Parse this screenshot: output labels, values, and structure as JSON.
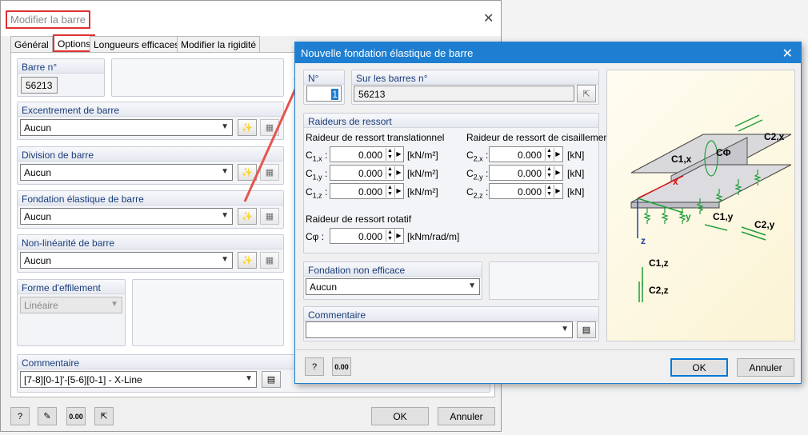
{
  "back_dialog": {
    "title": "Modifier la barre",
    "tabs": [
      "Général",
      "Options",
      "Longueurs efficaces",
      "Modifier la rigidité"
    ],
    "barre_label": "Barre n°",
    "barre_value": "56213",
    "excentrement": {
      "label": "Excentrement de barre",
      "value": "Aucun"
    },
    "division": {
      "label": "Division de barre",
      "value": "Aucun"
    },
    "fondation": {
      "label": "Fondation élastique de barre",
      "value": "Aucun"
    },
    "nonlinearite": {
      "label": "Non-linéarité de barre",
      "value": "Aucun"
    },
    "effilement": {
      "label": "Forme d'effilement",
      "value": "Linéaire"
    },
    "commentaire": {
      "label": "Commentaire",
      "value": "[7-8][0-1]'-[5-6][0-1] - X-Line"
    },
    "ok": "OK",
    "annuler": "Annuler"
  },
  "front_dialog": {
    "title": "Nouvelle fondation élastique de barre",
    "no_label": "N°",
    "no_value": "1",
    "barres_label": "Sur les barres n°",
    "barres_value": "56213",
    "raideurs_label": "Raideurs de ressort",
    "trans_label": "Raideur de ressort translationnel",
    "cis_label": "Raideur de ressort de cisaillement",
    "rot_label": "Raideur de ressort rotatif",
    "c1x": "C1,x :",
    "c1y": "C1,y :",
    "c1z": "C1,z :",
    "c2x": "C2,x :",
    "c2y": "C2,y :",
    "c2z": "C2,z :",
    "cphi": "Cφ :",
    "value_c1x": "0.000",
    "value_c1y": "0.000",
    "value_c1z": "0.000",
    "value_c2x": "0.000",
    "value_c2y": "0.000",
    "value_c2z": "0.000",
    "value_cphi": "0.000",
    "unit_knm2": "[kN/m²]",
    "unit_kn": "[kN]",
    "unit_rot": "[kNm/rad/m]",
    "fondation_label": "Fondation non efficace",
    "fondation_value": "Aucun",
    "comment_label": "Commentaire",
    "comment_value": "",
    "ok": "OK",
    "annuler": "Annuler",
    "diagram": {
      "c1x": "C1,x",
      "c2x": "C2,x",
      "cphi": "CΦ",
      "c1y": "C1,y",
      "c2y": "C2,y",
      "c1z": "C1,z",
      "c2z": "C2,z",
      "x": "x",
      "y": "y",
      "z": "z"
    }
  },
  "colors": {
    "accent": "#1e7fd2",
    "highlight": "#e03131",
    "spring": "#1f9e3a"
  }
}
